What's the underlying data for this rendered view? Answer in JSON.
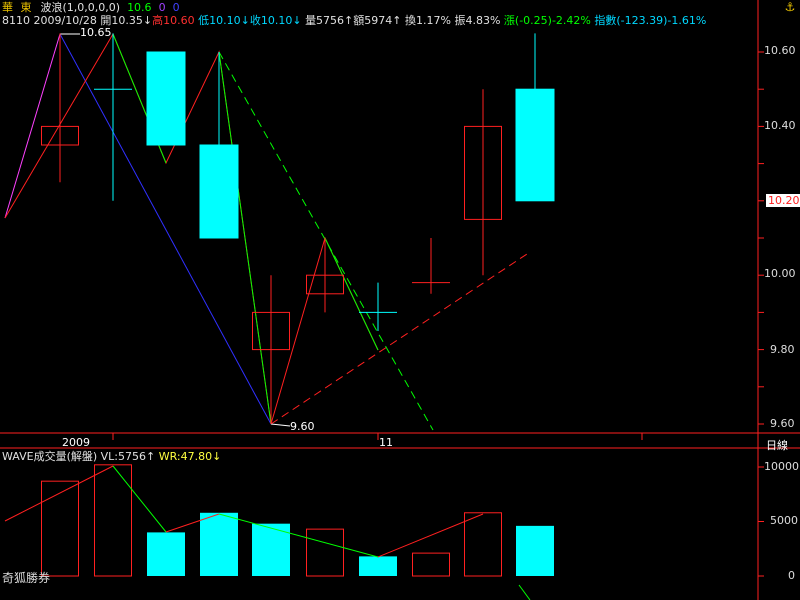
{
  "header": {
    "stock_name": "華 東",
    "indicator": "波浪(1,0,0,0,0)",
    "ind_value1": "10.6",
    "ind_value2": "0",
    "ind_value3": "0",
    "code": "8110",
    "date": "2009/10/28",
    "open": "開10.35↓",
    "high": "高10.60",
    "low": "低10.10↓",
    "close": "收10.10↓",
    "volume": "量5756↑",
    "amount": "額5974↑",
    "turnover": "換1.17%",
    "amplitude": "振4.83%",
    "change": "漲(-0.25)-2.42%",
    "index": "指數(-123.39)-1.61%"
  },
  "price_axis": {
    "ticks": [
      "10.60",
      "10.40",
      "10.20",
      "10.00",
      "9.80",
      "9.60"
    ],
    "current_marker": "10.20"
  },
  "annotations": {
    "high_label": "10.65",
    "low_label": "9.60"
  },
  "time_axis": {
    "year_label": "2009",
    "month_label": "11",
    "period_button": "日線"
  },
  "volume_panel": {
    "title": "WAVE成交量(解盤)",
    "vl_label": "VL:5756↑",
    "wr_label": "WR:47.80↓",
    "ticks": [
      "10000",
      "5000",
      "0"
    ]
  },
  "footer": {
    "broker": "奇狐勝券"
  },
  "colors": {
    "up": "#ff2020",
    "down": "#00ffff",
    "axis": "#ff2020",
    "gold": "#e8c000"
  },
  "chart_data": {
    "type": "candlestick",
    "candles": [
      {
        "open": 10.35,
        "high": 10.65,
        "low": 10.25,
        "close": 10.4
      },
      {
        "open": 10.5,
        "high": 10.65,
        "low": 10.2,
        "close": 10.5
      },
      {
        "open": 10.6,
        "high": 10.6,
        "low": 10.35,
        "close": 10.35
      },
      {
        "open": 10.35,
        "high": 10.6,
        "low": 10.35,
        "close": 10.1
      },
      {
        "open": 9.8,
        "high": 10.0,
        "low": 9.6,
        "close": 9.9
      },
      {
        "open": 9.95,
        "high": 10.1,
        "low": 9.9,
        "close": 10.0
      },
      {
        "open": 9.9,
        "high": 9.98,
        "low": 9.85,
        "close": 9.9
      },
      {
        "open": 9.98,
        "high": 10.1,
        "low": 9.95,
        "close": 9.98
      },
      {
        "open": 10.15,
        "high": 10.5,
        "low": 10.0,
        "close": 10.4
      },
      {
        "open": 10.5,
        "high": 10.65,
        "low": 10.2,
        "close": 10.2
      }
    ],
    "ylim": [
      9.55,
      10.7
    ],
    "volume": {
      "values": [
        8700,
        10200,
        4000,
        5800,
        4800,
        4300,
        1800,
        2100,
        5800,
        4600
      ],
      "up": [
        true,
        true,
        false,
        false,
        false,
        true,
        false,
        true,
        true,
        false
      ],
      "ylim": [
        0,
        11000
      ]
    }
  }
}
